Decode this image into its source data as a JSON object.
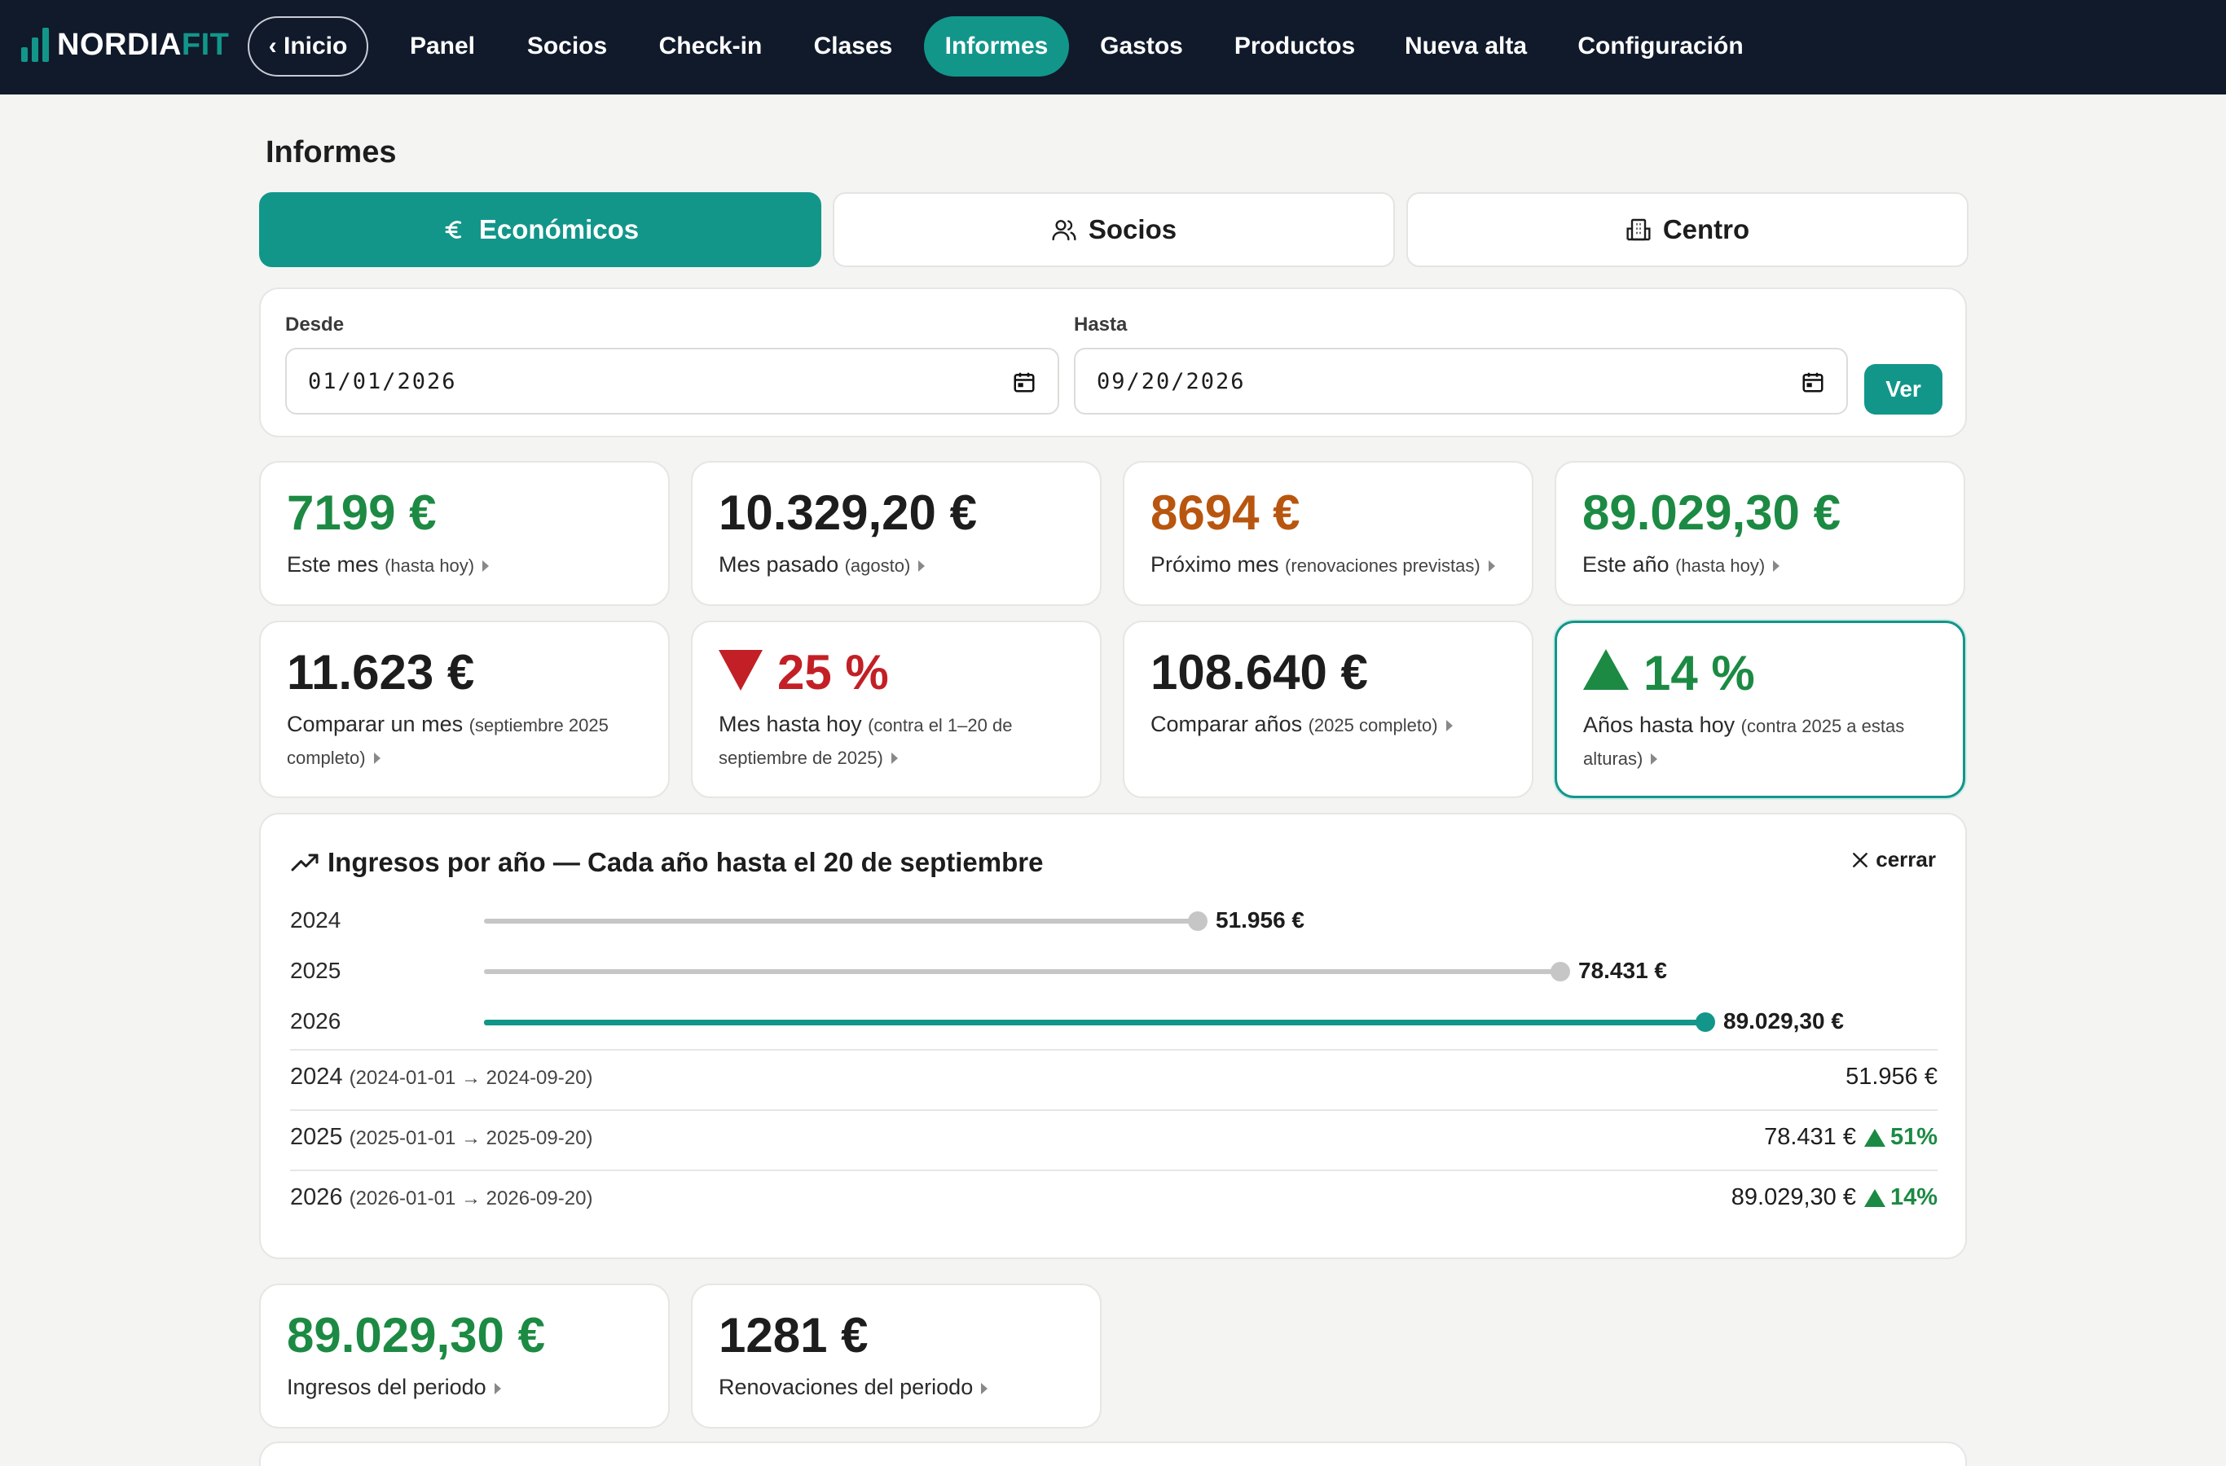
{
  "brand": {
    "part1": "NORDIA",
    "part2": "FIT"
  },
  "nav": {
    "back": "‹ Inicio",
    "items": [
      {
        "label": "Panel"
      },
      {
        "label": "Socios"
      },
      {
        "label": "Check-in"
      },
      {
        "label": "Clases"
      },
      {
        "label": "Informes",
        "active": true
      },
      {
        "label": "Gastos"
      },
      {
        "label": "Productos"
      },
      {
        "label": "Nueva alta"
      },
      {
        "label": "Configuración"
      }
    ]
  },
  "page": {
    "title": "Informes"
  },
  "tabs": [
    {
      "label": "Económicos",
      "icon": "euro-icon",
      "active": true
    },
    {
      "label": "Socios",
      "icon": "users-icon"
    },
    {
      "label": "Centro",
      "icon": "building-icon"
    }
  ],
  "filter": {
    "from_label": "Desde",
    "from_value": "01/01/2026",
    "to_label": "Hasta",
    "to_value": "09/20/2026",
    "submit": "Ver"
  },
  "kpis_row1": [
    {
      "value": "7199 €",
      "label": "Este mes",
      "note": "(hasta hoy)",
      "color": "#1c8a43"
    },
    {
      "value": "10.329,20 €",
      "label": "Mes pasado",
      "note": "(agosto)",
      "color": "#1d1d1d"
    },
    {
      "value": "8694 €",
      "label": "Próximo mes",
      "note": "(renovaciones previstas)",
      "color": "#b8560f"
    },
    {
      "value": "89.029,30 €",
      "label": "Este año",
      "note": "(hasta hoy)",
      "color": "#1c8a43"
    }
  ],
  "kpis_row2": [
    {
      "value": "11.623 €",
      "label": "Comparar un mes",
      "note": "(septiembre 2025 completo)",
      "color": "#1d1d1d"
    },
    {
      "value": "25 %",
      "label": "Mes hasta hoy",
      "note": "(contra el 1–20 de septiembre de 2025)",
      "color": "#c22026",
      "trend": "down"
    },
    {
      "value": "108.640 €",
      "label": "Comparar años",
      "note": "(2025 completo)",
      "color": "#1d1d1d"
    },
    {
      "value": "14 %",
      "label": "Años hasta hoy",
      "note": "(contra 2025 a estas alturas)",
      "color": "#1c8a43",
      "trend": "up",
      "selected": true
    }
  ],
  "year_panel": {
    "title": "Ingresos por año — Cada año hasta el 20 de septiembre",
    "close": "cerrar",
    "chart_data": {
      "type": "bar",
      "orientation": "horizontal",
      "categories": [
        "2024",
        "2025",
        "2026"
      ],
      "values": [
        51956,
        78431,
        89029.3
      ],
      "value_labels": [
        "51.956 €",
        "78.431 €",
        "89.029,30 €"
      ],
      "highlight": "2026",
      "colors": {
        "default": "#c6c6c6",
        "highlight": "#12968a"
      }
    },
    "rows": [
      {
        "year": "2024",
        "range": "(2024-01-01 → 2024-09-20)",
        "amount": "51.956 €",
        "change": ""
      },
      {
        "year": "2025",
        "range": "(2025-01-01 → 2025-09-20)",
        "amount": "78.431 €",
        "change": "51%"
      },
      {
        "year": "2026",
        "range": "(2026-01-01 → 2026-09-20)",
        "amount": "89.029,30 €",
        "change": "14%"
      }
    ]
  },
  "kpis_row3": [
    {
      "value": "89.029,30 €",
      "label": "Ingresos del periodo",
      "color": "#1c8a43"
    },
    {
      "value": "1281 €",
      "label": "Renovaciones del periodo",
      "color": "#1d1d1d"
    }
  ]
}
